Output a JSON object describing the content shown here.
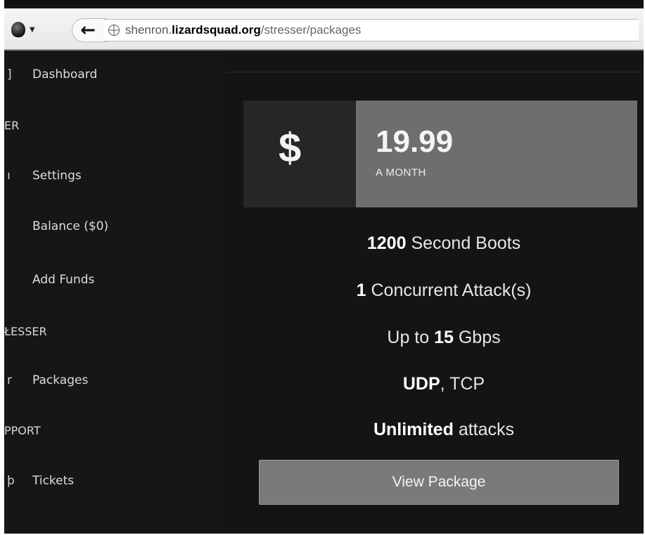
{
  "browser": {
    "url_prefix": "shenron.",
    "url_domain": "lizardsquad.org",
    "url_path": "/stresser/packages",
    "back_icon": "left-arrow-icon",
    "site_icon": "globe-icon"
  },
  "sidebar": {
    "items": [
      {
        "glyph": "]",
        "label": "Dashboard"
      },
      {
        "heading": "ER"
      },
      {
        "glyph": "ı",
        "label": "Settings"
      },
      {
        "label": "Balance ($0)"
      },
      {
        "label": "Add Funds"
      },
      {
        "heading": "ŁESSER"
      },
      {
        "glyph": "r",
        "label": "Packages"
      },
      {
        "heading": "PPORT"
      },
      {
        "glyph": "þ",
        "label": "Tickets"
      }
    ]
  },
  "package": {
    "currency": "$",
    "price": "19.99",
    "period": "A MONTH",
    "features": [
      {
        "strong": "1200",
        "text": " Second Boots"
      },
      {
        "strong": "1",
        "text": " Concurrent Attack(s)"
      },
      {
        "pre": "Up to ",
        "strong": "15",
        "text": " Gbps"
      },
      {
        "strong": "UDP",
        "text": ", TCP"
      },
      {
        "strong": "Unlimited",
        "text": " attacks"
      }
    ],
    "button_label": "View Package"
  },
  "colors": {
    "background": "#141414",
    "price_panel": "#6e6e6e",
    "button": "#7a7a7a",
    "text": "#e6e6e6"
  }
}
